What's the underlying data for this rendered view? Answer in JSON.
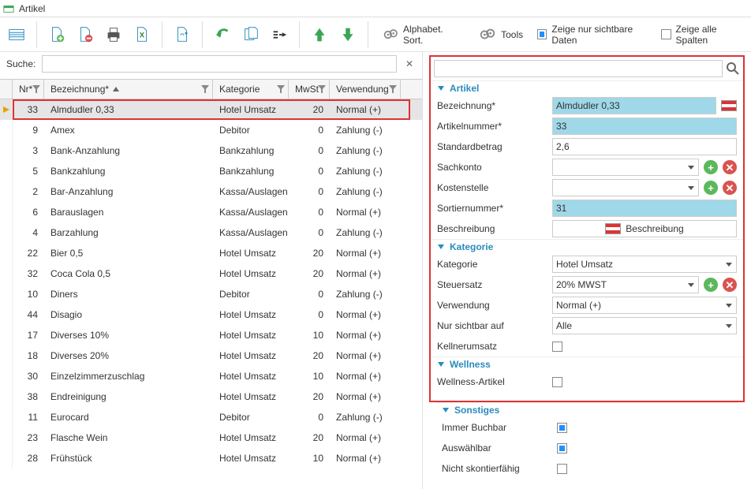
{
  "window": {
    "title": "Artikel"
  },
  "toolbar": {
    "alpha_sort": "Alphabet. Sort.",
    "tools": "Tools",
    "show_visible_only": "Zeige nur sichtbare Daten",
    "show_all_columns": "Zeige alle Spalten"
  },
  "search": {
    "label": "Suche:"
  },
  "columns": {
    "nr": "Nr*",
    "bez": "Bezeichnung*",
    "kat": "Kategorie",
    "mwst": "MwSt",
    "verw": "Verwendung"
  },
  "rows": [
    {
      "nr": "33",
      "bez": "Almdudler 0,33",
      "kat": "Hotel Umsatz",
      "mwst": "20",
      "verw": "Normal (+)",
      "selected": true
    },
    {
      "nr": "9",
      "bez": "Amex",
      "kat": "Debitor",
      "mwst": "0",
      "verw": "Zahlung (-)"
    },
    {
      "nr": "3",
      "bez": "Bank-Anzahlung",
      "kat": "Bankzahlung",
      "mwst": "0",
      "verw": "Zahlung (-)"
    },
    {
      "nr": "5",
      "bez": "Bankzahlung",
      "kat": "Bankzahlung",
      "mwst": "0",
      "verw": "Zahlung (-)"
    },
    {
      "nr": "2",
      "bez": "Bar-Anzahlung",
      "kat": "Kassa/Auslagen",
      "mwst": "0",
      "verw": "Zahlung (-)"
    },
    {
      "nr": "6",
      "bez": "Barauslagen",
      "kat": "Kassa/Auslagen",
      "mwst": "0",
      "verw": "Normal (+)"
    },
    {
      "nr": "4",
      "bez": "Barzahlung",
      "kat": "Kassa/Auslagen",
      "mwst": "0",
      "verw": "Zahlung (-)"
    },
    {
      "nr": "22",
      "bez": "Bier 0,5",
      "kat": "Hotel Umsatz",
      "mwst": "20",
      "verw": "Normal (+)"
    },
    {
      "nr": "32",
      "bez": "Coca Cola 0,5",
      "kat": "Hotel Umsatz",
      "mwst": "20",
      "verw": "Normal (+)"
    },
    {
      "nr": "10",
      "bez": "Diners",
      "kat": "Debitor",
      "mwst": "0",
      "verw": "Zahlung (-)"
    },
    {
      "nr": "44",
      "bez": "Disagio",
      "kat": "Hotel Umsatz",
      "mwst": "0",
      "verw": "Normal (+)"
    },
    {
      "nr": "17",
      "bez": "Diverses 10%",
      "kat": "Hotel Umsatz",
      "mwst": "10",
      "verw": "Normal (+)"
    },
    {
      "nr": "18",
      "bez": "Diverses 20%",
      "kat": "Hotel Umsatz",
      "mwst": "20",
      "verw": "Normal (+)"
    },
    {
      "nr": "30",
      "bez": "Einzelzimmerzuschlag",
      "kat": "Hotel Umsatz",
      "mwst": "10",
      "verw": "Normal (+)"
    },
    {
      "nr": "38",
      "bez": "Endreinigung",
      "kat": "Hotel Umsatz",
      "mwst": "20",
      "verw": "Normal (+)"
    },
    {
      "nr": "11",
      "bez": "Eurocard",
      "kat": "Debitor",
      "mwst": "0",
      "verw": "Zahlung (-)"
    },
    {
      "nr": "23",
      "bez": "Flasche Wein",
      "kat": "Hotel Umsatz",
      "mwst": "20",
      "verw": "Normal (+)"
    },
    {
      "nr": "28",
      "bez": "Frühstück",
      "kat": "Hotel Umsatz",
      "mwst": "10",
      "verw": "Normal (+)"
    }
  ],
  "detail": {
    "sections": {
      "artikel": "Artikel",
      "kategorie": "Kategorie",
      "wellness": "Wellness",
      "sonstiges": "Sonstiges"
    },
    "labels": {
      "bezeichnung": "Bezeichnung*",
      "artikelnummer": "Artikelnummer*",
      "standardbetrag": "Standardbetrag",
      "sachkonto": "Sachkonto",
      "kostenstelle": "Kostenstelle",
      "sortiernummer": "Sortiernummer*",
      "beschreibung": "Beschreibung",
      "kategorie": "Kategorie",
      "steuersatz": "Steuersatz",
      "verwendung": "Verwendung",
      "nur_sichtbar_auf": "Nur sichtbar auf",
      "kellnerumsatz": "Kellnerumsatz",
      "wellness_artikel": "Wellness-Artikel",
      "immer_buchbar": "Immer Buchbar",
      "auswaehlbar": "Auswählbar",
      "nicht_skontierfaehig": "Nicht skontierfähig"
    },
    "values": {
      "bezeichnung": "Almdudler 0,33",
      "artikelnummer": "33",
      "standardbetrag": "2,6",
      "sachkonto": "",
      "kostenstelle": "",
      "sortiernummer": "31",
      "beschreibung_btn": "Beschreibung",
      "kategorie": "Hotel Umsatz",
      "steuersatz": "20% MWST",
      "verwendung": "Normal (+)",
      "nur_sichtbar_auf": "Alle"
    }
  }
}
